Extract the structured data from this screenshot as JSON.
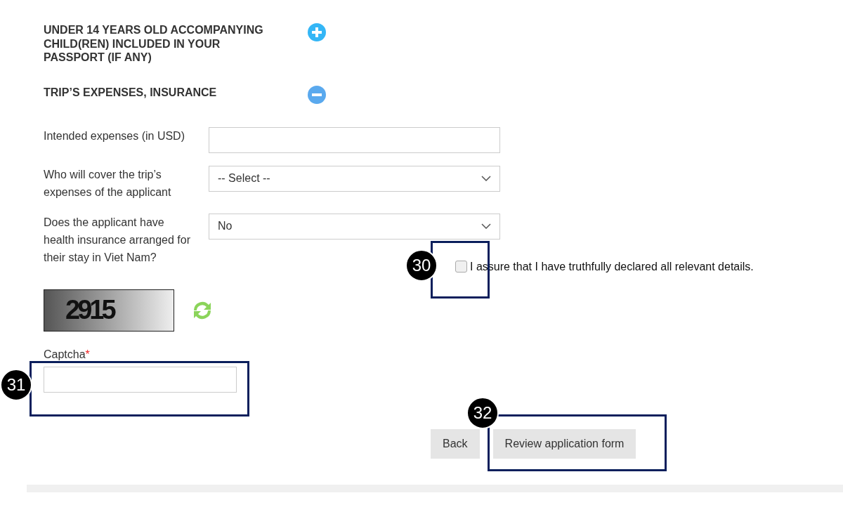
{
  "sections": [
    {
      "title": "UNDER 14 YEARS OLD ACCOMPANYING CHILD(REN) INCLUDED IN YOUR PASSPORT (IF ANY)",
      "expanded": false
    },
    {
      "title": "TRIP’S EXPENSES, INSURANCE",
      "expanded": true
    }
  ],
  "fields": [
    {
      "kind": "text",
      "label": "Intended expenses (in USD)"
    },
    {
      "kind": "select",
      "label": "Who will cover the trip’s expenses of the applicant",
      "value": "-- Select --"
    },
    {
      "kind": "select",
      "label": "Does the applicant have health insurance arranged for their stay in Viet Nam?",
      "value": "No"
    }
  ],
  "declaration": {
    "label": "I assure that I have truthfully declared all relevant details.",
    "checked": false
  },
  "captcha": {
    "code": "2915",
    "label": "Captcha",
    "required_mark": "*"
  },
  "buttons": [
    {
      "label": "Back"
    },
    {
      "label": "Review application form"
    }
  ],
  "callouts": [
    {
      "number": "30"
    },
    {
      "number": "31"
    },
    {
      "number": "32"
    }
  ]
}
